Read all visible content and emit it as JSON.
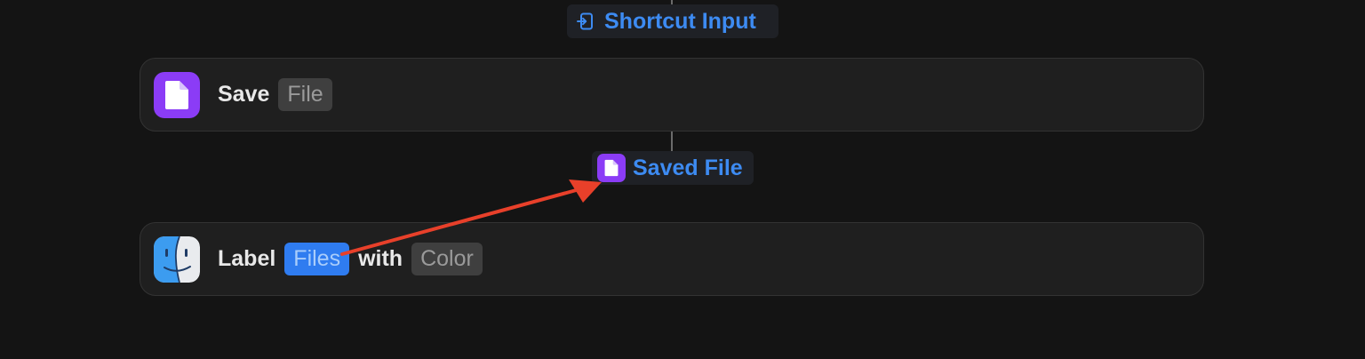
{
  "top_output": {
    "label": "Shortcut Input",
    "icon": "shortcut-input-icon"
  },
  "actions": [
    {
      "verb": "Save",
      "icon": "document-icon",
      "icon_color": "#8b3cf6",
      "param_placeholder": "File"
    },
    {
      "verb": "Label",
      "icon": "finder-icon",
      "param_variable": "Files",
      "connector_word": "with",
      "param_placeholder": "Color"
    }
  ],
  "middle_output": {
    "label": "Saved File",
    "icon": "document-icon",
    "icon_color": "#8b3cf6"
  },
  "annotation": {
    "type": "arrow",
    "color": "#e8402a",
    "from": "files-variable-token",
    "to": "saved-file-output"
  },
  "colors": {
    "background": "#141414",
    "accent_blue": "#3d8bf2",
    "card": "#1f1f1f"
  }
}
